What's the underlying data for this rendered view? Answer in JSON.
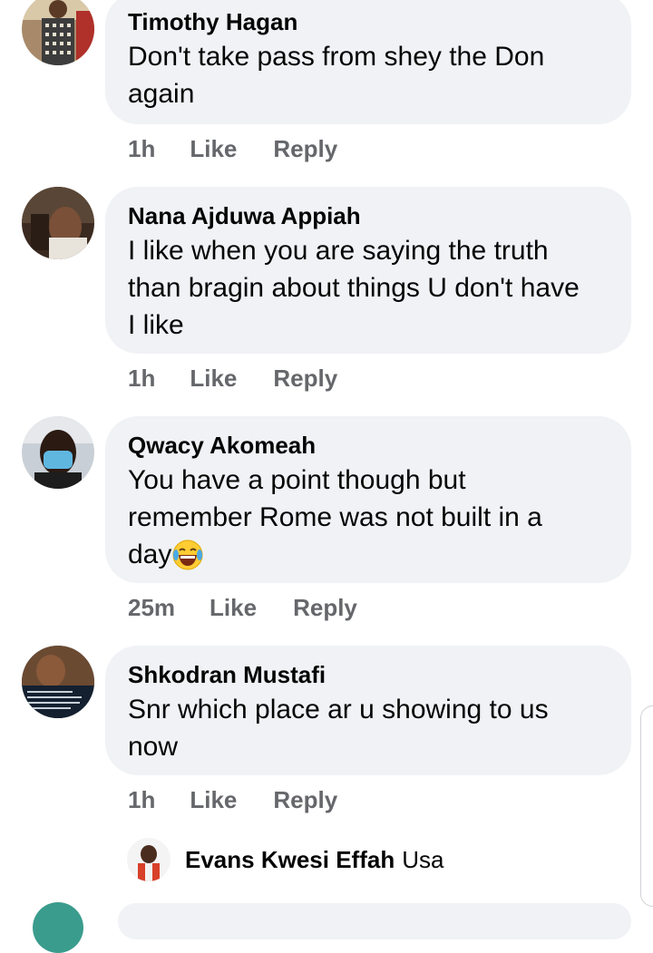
{
  "comments": [
    {
      "author": "Timothy Hagan",
      "lines": [
        "Don't take pass from shey the Don",
        "again"
      ],
      "time": "1h",
      "like": "Like",
      "reply": "Reply"
    },
    {
      "author": "Nana Ajduwa Appiah",
      "lines": [
        "I like when you are saying the truth",
        "than bragin about things U don't have",
        "I like"
      ],
      "time": "1h",
      "like": "Like",
      "reply": "Reply"
    },
    {
      "author": "Qwacy Akomeah",
      "lines": [
        "You have a point though but",
        "remember Rome was not built in a",
        "day"
      ],
      "time": "25m",
      "like": "Like",
      "reply": "Reply",
      "emoji": "laughing-crying-emoji"
    },
    {
      "author": "Shkodran Mustafi",
      "lines": [
        "Snr which place ar u showing to us",
        "now"
      ],
      "time": "1h",
      "like": "Like",
      "reply": "Reply"
    }
  ],
  "reply_preview": {
    "author": "Evans Kwesi Effah",
    "snippet": "Usa"
  },
  "colors": {
    "bubble": "#f0f2f5",
    "meta": "#65676b",
    "text": "#050505"
  }
}
